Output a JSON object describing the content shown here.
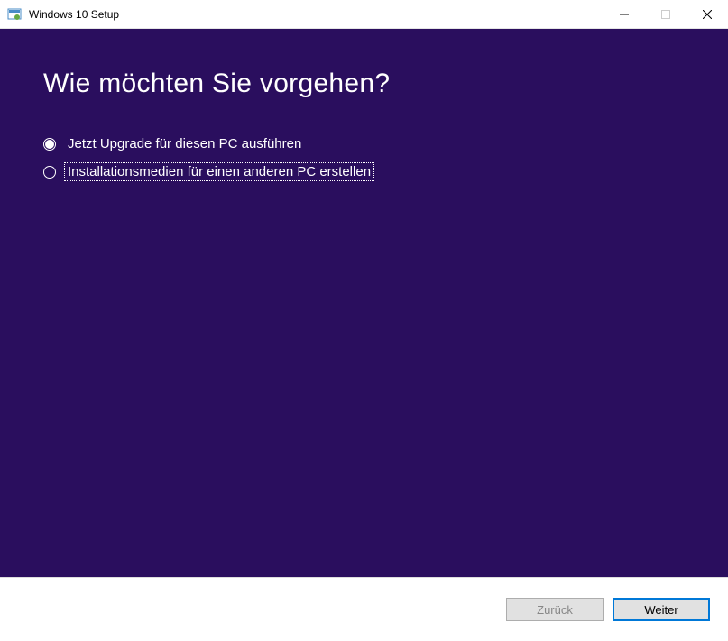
{
  "titlebar": {
    "title": "Windows 10 Setup"
  },
  "content": {
    "heading": "Wie möchten Sie vorgehen?",
    "options": [
      {
        "label": "Jetzt Upgrade für diesen PC ausführen"
      },
      {
        "label": "Installationsmedien für einen anderen PC erstellen"
      }
    ]
  },
  "footer": {
    "back_label": "Zurück",
    "next_label": "Weiter"
  }
}
